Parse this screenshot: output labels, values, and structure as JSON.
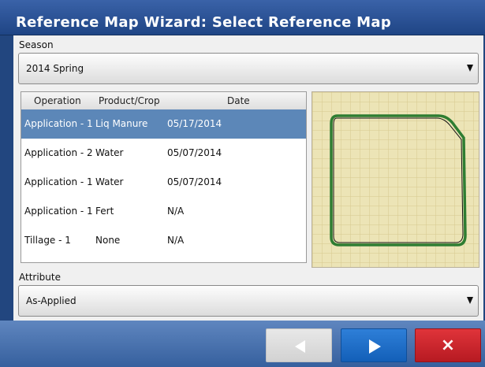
{
  "window": {
    "title": "Reference Map Wizard: Select Reference Map"
  },
  "season": {
    "label": "Season",
    "value": "2014 Spring"
  },
  "operations": {
    "headers": {
      "operation": "Operation",
      "product": "Product/Crop",
      "date": "Date"
    },
    "rows": [
      {
        "operation": "Application - 1",
        "product": "Liq Manure",
        "date": "05/17/2014"
      },
      {
        "operation": "Application - 2",
        "product": "Water",
        "date": "05/07/2014"
      },
      {
        "operation": "Application - 1",
        "product": "Water",
        "date": "05/07/2014"
      },
      {
        "operation": "Application - 1",
        "product": "Fert",
        "date": "N/A"
      },
      {
        "operation": "Tillage - 1",
        "product": "None",
        "date": "N/A"
      }
    ],
    "selected_index": 0
  },
  "attribute": {
    "label": "Attribute",
    "value": "As-Applied"
  },
  "footer": {
    "cancel_icon": "×"
  },
  "icons": {
    "dropdown": "chevron-down-icon",
    "back": "arrow-left-icon",
    "next": "arrow-right-icon",
    "cancel": "close-icon"
  },
  "colors": {
    "selection": "#5c87b8",
    "map_background": "#ece4b6",
    "field_outline": "#2e7d32",
    "next": "#1f6fc8",
    "cancel": "#c8232b"
  }
}
